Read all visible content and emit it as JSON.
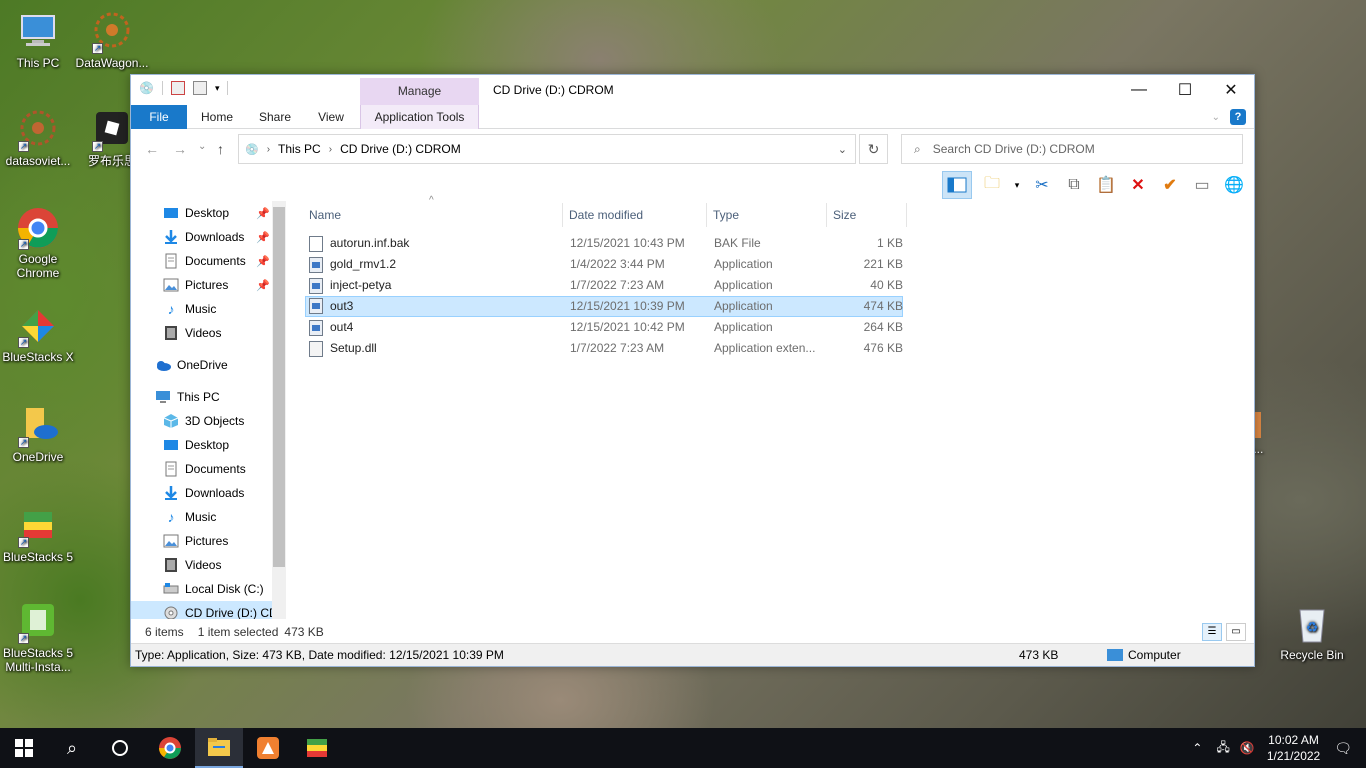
{
  "desktop": {
    "icons": [
      {
        "label": "This PC",
        "icon": "monitor"
      },
      {
        "label": "DataWagon...",
        "icon": "sunburst"
      },
      {
        "label": "datasoviet...",
        "icon": "sunburst"
      },
      {
        "label": "罗布乐思",
        "icon": "roblox"
      },
      {
        "label": "Google Chrome",
        "icon": "chrome"
      },
      {
        "label": "BlueStacks X",
        "icon": "bluestacks-x"
      },
      {
        "label": "OneDrive",
        "icon": "onedrive-folder"
      },
      {
        "label": "BlueStacks 5",
        "icon": "bluestacks"
      },
      {
        "label": "BlueStacks 5 Multi-Insta...",
        "icon": "bluestacks-multi"
      },
      {
        "label": "Recycle Bin",
        "icon": "recycle-bin"
      }
    ],
    "partial_label": "o..."
  },
  "window": {
    "title": "CD Drive (D:) CDROM",
    "manage_label": "Manage",
    "tabs": [
      "File",
      "Home",
      "Share",
      "View",
      "Application Tools"
    ],
    "breadcrumb": [
      "This PC",
      "CD Drive (D:) CDROM"
    ],
    "search_placeholder": "Search CD Drive (D:) CDROM"
  },
  "nav_pane": {
    "quick_access": [
      {
        "label": "Desktop",
        "icon": "desktop",
        "pinned": true
      },
      {
        "label": "Downloads",
        "icon": "download",
        "pinned": true
      },
      {
        "label": "Documents",
        "icon": "document",
        "pinned": true
      },
      {
        "label": "Pictures",
        "icon": "pictures",
        "pinned": true
      },
      {
        "label": "Music",
        "icon": "music",
        "pinned": false
      },
      {
        "label": "Videos",
        "icon": "videos",
        "pinned": false
      }
    ],
    "onedrive": "OneDrive",
    "this_pc": "This PC",
    "this_pc_items": [
      {
        "label": "3D Objects",
        "icon": "cube"
      },
      {
        "label": "Desktop",
        "icon": "desktop"
      },
      {
        "label": "Documents",
        "icon": "document"
      },
      {
        "label": "Downloads",
        "icon": "download"
      },
      {
        "label": "Music",
        "icon": "music"
      },
      {
        "label": "Pictures",
        "icon": "pictures"
      },
      {
        "label": "Videos",
        "icon": "videos"
      },
      {
        "label": "Local Disk (C:)",
        "icon": "disk"
      },
      {
        "label": "CD Drive (D:) CD",
        "icon": "cd"
      }
    ]
  },
  "file_list": {
    "columns": [
      "Name",
      "Date modified",
      "Type",
      "Size"
    ],
    "rows": [
      {
        "name": "autorun.inf.bak",
        "date": "12/15/2021 10:43 PM",
        "type": "BAK File",
        "size": "1 KB",
        "icon": "file",
        "selected": false
      },
      {
        "name": "gold_rmv1.2",
        "date": "1/4/2022 3:44 PM",
        "type": "Application",
        "size": "221 KB",
        "icon": "app",
        "selected": false
      },
      {
        "name": "inject-petya",
        "date": "1/7/2022 7:23 AM",
        "type": "Application",
        "size": "40 KB",
        "icon": "app",
        "selected": false
      },
      {
        "name": "out3",
        "date": "12/15/2021 10:39 PM",
        "type": "Application",
        "size": "474 KB",
        "icon": "app",
        "selected": true
      },
      {
        "name": "out4",
        "date": "12/15/2021 10:42 PM",
        "type": "Application",
        "size": "264 KB",
        "icon": "app",
        "selected": false
      },
      {
        "name": "Setup.dll",
        "date": "1/7/2022 7:23 AM",
        "type": "Application exten...",
        "size": "476 KB",
        "icon": "dll",
        "selected": false
      }
    ]
  },
  "status": {
    "item_count": "6 items",
    "selected": "1 item selected",
    "selected_size": "473 KB"
  },
  "details_bar": {
    "text": "Type: Application, Size: 473 KB, Date modified: 12/15/2021 10:39 PM",
    "size": "473 KB",
    "location": "Computer"
  },
  "taskbar": {
    "time": "10:02 AM",
    "date": "1/21/2022"
  }
}
